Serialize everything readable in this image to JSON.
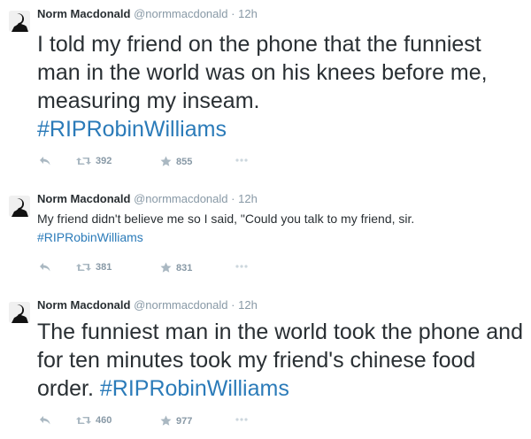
{
  "tweets": [
    {
      "name": "Norm Macdonald",
      "handle": "@normmacdonald",
      "separator": "·",
      "time": "12h",
      "text": "I told my friend on the phone that the funniest man in the world was on his knees before me, measuring my inseam.",
      "hashtag": "#RIPRobinWilliams",
      "retweets": "392",
      "favorites": "855"
    },
    {
      "name": "Norm Macdonald",
      "handle": "@normmacdonald",
      "separator": "·",
      "time": "12h",
      "text": "My friend didn't believe me so I said, \"Could you talk to my friend, sir.",
      "hashtag": "#RIPRobinWilliams",
      "retweets": "381",
      "favorites": "831"
    },
    {
      "name": "Norm Macdonald",
      "handle": "@normmacdonald",
      "separator": "·",
      "time": "12h",
      "text": "The funniest man in the world took the phone and for ten minutes took my friend's chinese food order.",
      "hashtag": "#RIPRobinWilliams",
      "retweets": "460",
      "favorites": "977"
    }
  ],
  "icons": {
    "reply": "reply-icon",
    "retweet": "retweet-icon",
    "favorite": "star-icon",
    "more": "more-icon"
  },
  "colors": {
    "hashtag": "#2b7bb9",
    "muted": "#8899a6",
    "text": "#292f33"
  }
}
